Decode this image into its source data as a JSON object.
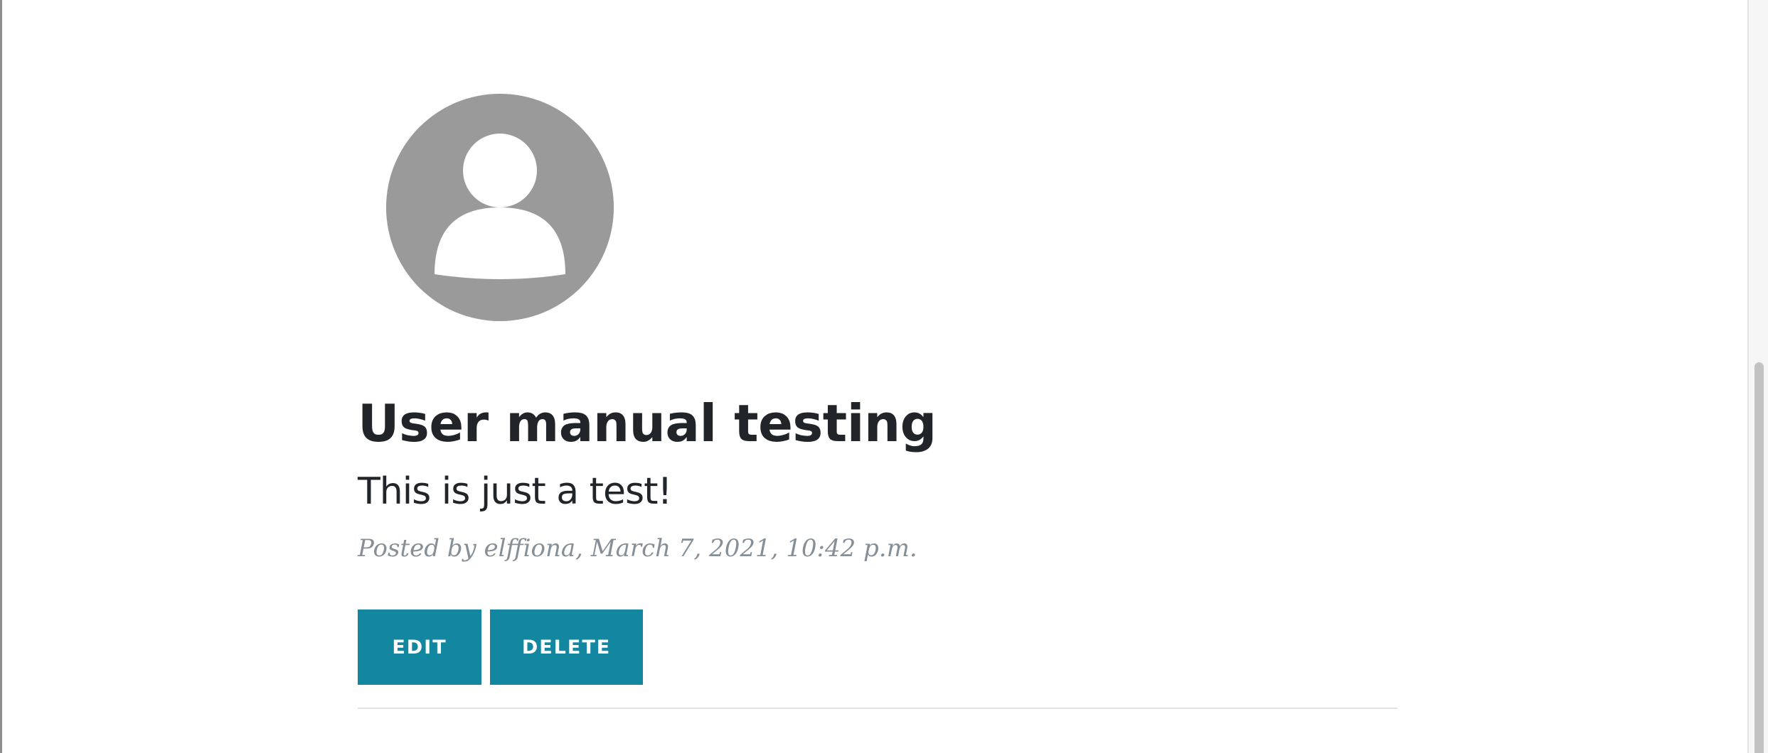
{
  "post": {
    "avatar_icon": "default-user-avatar-icon",
    "title": "User manual testing",
    "body": "This is just a test!",
    "meta": "Posted by elffiona, March 7, 2021, 10:42 p.m.",
    "actions": {
      "edit_label": "EDIT",
      "delete_label": "DELETE"
    }
  },
  "colors": {
    "button_background": "#13879f",
    "button_text": "#ffffff",
    "title_text": "#212529",
    "meta_text": "#868e96",
    "avatar_background": "#9a9a9a"
  }
}
